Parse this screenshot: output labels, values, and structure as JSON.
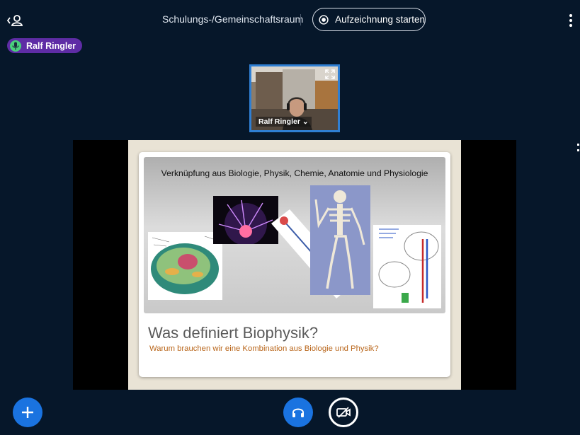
{
  "header": {
    "room_title": "Schulungs-/Gemeinschaftsraum",
    "record_label": "Aufzeichnung starten",
    "icons": {
      "users": "user-list-icon",
      "record": "record-icon",
      "options": "vertical-dots-icon"
    }
  },
  "talker": {
    "name": "Ralf Ringler",
    "icon": "microphone-icon",
    "color": "#5e2ca5"
  },
  "webcam": {
    "user_name": "Ralf Ringler",
    "name_suffix": "⌄",
    "icon": "fullscreen-icon"
  },
  "slide": {
    "heading": "Verknüpfung aus Biologie, Physik, Chemie, Anatomie und Physiologie",
    "title": "Was definiert Biophysik?",
    "subtitle": "Warum brauchen wir eine Kombination aus Biologie und Physik?"
  },
  "controls": {
    "actions_icon": "plus-icon",
    "audio_icon": "headphones-icon",
    "video_icon": "video-off-icon",
    "accent": "#1a73e0"
  }
}
